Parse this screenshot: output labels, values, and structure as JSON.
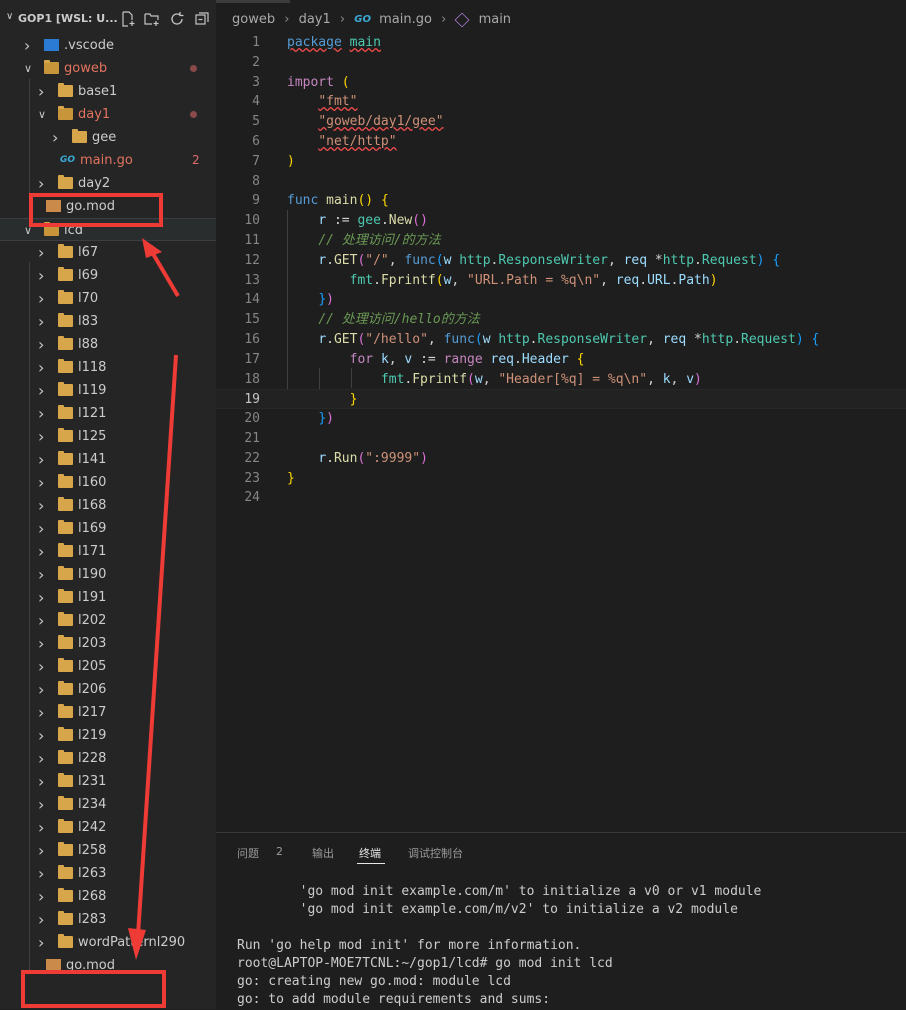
{
  "sidebar": {
    "title": "GOP1 [WSL: U...",
    "tree": [
      {
        "label": ".vscode",
        "icon": "vscode-folder-icon",
        "expanded": false,
        "level": 1
      },
      {
        "label": "goweb",
        "icon": "folder-open-icon",
        "expanded": true,
        "level": 1,
        "modified": true
      },
      {
        "label": "base1",
        "icon": "folder-icon",
        "expanded": false,
        "level": 2
      },
      {
        "label": "day1",
        "icon": "folder-open-icon",
        "expanded": true,
        "level": 2,
        "modified": true
      },
      {
        "label": "gee",
        "icon": "folder-icon",
        "expanded": false,
        "level": 3
      },
      {
        "label": "main.go",
        "icon": "go-file-icon",
        "level": 3,
        "problems": "2"
      },
      {
        "label": "day2",
        "icon": "folder-icon",
        "expanded": false,
        "level": 2
      },
      {
        "label": "go.mod",
        "icon": "gomod-file-icon",
        "level": 2
      },
      {
        "label": "lcd",
        "icon": "folder-open-icon",
        "expanded": true,
        "level": 1,
        "selected": true
      },
      {
        "label": "l67",
        "icon": "folder-icon",
        "expanded": false,
        "level": 2
      },
      {
        "label": "l69",
        "icon": "folder-icon",
        "expanded": false,
        "level": 2
      },
      {
        "label": "l70",
        "icon": "folder-icon",
        "expanded": false,
        "level": 2
      },
      {
        "label": "l83",
        "icon": "folder-icon",
        "expanded": false,
        "level": 2
      },
      {
        "label": "l88",
        "icon": "folder-icon",
        "expanded": false,
        "level": 2
      },
      {
        "label": "l118",
        "icon": "folder-icon",
        "expanded": false,
        "level": 2
      },
      {
        "label": "l119",
        "icon": "folder-icon",
        "expanded": false,
        "level": 2
      },
      {
        "label": "l121",
        "icon": "folder-icon",
        "expanded": false,
        "level": 2
      },
      {
        "label": "l125",
        "icon": "folder-icon",
        "expanded": false,
        "level": 2
      },
      {
        "label": "l141",
        "icon": "folder-icon",
        "expanded": false,
        "level": 2
      },
      {
        "label": "l160",
        "icon": "folder-icon",
        "expanded": false,
        "level": 2
      },
      {
        "label": "l168",
        "icon": "folder-icon",
        "expanded": false,
        "level": 2
      },
      {
        "label": "l169",
        "icon": "folder-icon",
        "expanded": false,
        "level": 2
      },
      {
        "label": "l171",
        "icon": "folder-icon",
        "expanded": false,
        "level": 2
      },
      {
        "label": "l190",
        "icon": "folder-icon",
        "expanded": false,
        "level": 2
      },
      {
        "label": "l191",
        "icon": "folder-icon",
        "expanded": false,
        "level": 2
      },
      {
        "label": "l202",
        "icon": "folder-icon",
        "expanded": false,
        "level": 2
      },
      {
        "label": "l203",
        "icon": "folder-icon",
        "expanded": false,
        "level": 2
      },
      {
        "label": "l205",
        "icon": "folder-icon",
        "expanded": false,
        "level": 2
      },
      {
        "label": "l206",
        "icon": "folder-icon",
        "expanded": false,
        "level": 2
      },
      {
        "label": "l217",
        "icon": "folder-icon",
        "expanded": false,
        "level": 2
      },
      {
        "label": "l219",
        "icon": "folder-icon",
        "expanded": false,
        "level": 2
      },
      {
        "label": "l228",
        "icon": "folder-icon",
        "expanded": false,
        "level": 2
      },
      {
        "label": "l231",
        "icon": "folder-icon",
        "expanded": false,
        "level": 2
      },
      {
        "label": "l234",
        "icon": "folder-icon",
        "expanded": false,
        "level": 2
      },
      {
        "label": "l242",
        "icon": "folder-icon",
        "expanded": false,
        "level": 2
      },
      {
        "label": "l258",
        "icon": "folder-icon",
        "expanded": false,
        "level": 2
      },
      {
        "label": "l263",
        "icon": "folder-icon",
        "expanded": false,
        "level": 2
      },
      {
        "label": "l268",
        "icon": "folder-icon",
        "expanded": false,
        "level": 2
      },
      {
        "label": "l283",
        "icon": "folder-icon",
        "expanded": false,
        "level": 2
      },
      {
        "label": "wordPatternl290",
        "icon": "folder-icon",
        "expanded": false,
        "level": 2
      },
      {
        "label": "go.mod",
        "icon": "gomod-file-icon",
        "level": 2
      }
    ]
  },
  "breadcrumb": [
    "goweb",
    "day1",
    "main.go",
    "main"
  ],
  "editor": {
    "current_line": 19,
    "lines": [
      [
        {
          "t": "package",
          "c": "kw2 squig"
        },
        {
          "t": " ",
          "c": "plain"
        },
        {
          "t": "main",
          "c": "pkg squig"
        }
      ],
      [],
      [
        {
          "t": "import",
          "c": "kw"
        },
        {
          "t": " ",
          "c": "plain"
        },
        {
          "t": "(",
          "c": "br1"
        }
      ],
      [
        {
          "t": "    ",
          "c": "plain"
        },
        {
          "t": "\"fmt\"",
          "c": "str squig"
        }
      ],
      [
        {
          "t": "    ",
          "c": "plain"
        },
        {
          "t": "\"goweb/day1/gee\"",
          "c": "str squig"
        }
      ],
      [
        {
          "t": "    ",
          "c": "plain"
        },
        {
          "t": "\"net/http\"",
          "c": "str squig"
        }
      ],
      [
        {
          "t": ")",
          "c": "br1"
        }
      ],
      [],
      [
        {
          "t": "func",
          "c": "kw2"
        },
        {
          "t": " ",
          "c": "plain"
        },
        {
          "t": "main",
          "c": "fn"
        },
        {
          "t": "()",
          "c": "br1"
        },
        {
          "t": " ",
          "c": "plain"
        },
        {
          "t": "{",
          "c": "br1"
        }
      ],
      [
        {
          "t": "    ",
          "c": "plain"
        },
        {
          "t": "r",
          "c": "id"
        },
        {
          "t": " := ",
          "c": "plain"
        },
        {
          "t": "gee",
          "c": "pkg"
        },
        {
          "t": ".",
          "c": "plain"
        },
        {
          "t": "New",
          "c": "fn"
        },
        {
          "t": "()",
          "c": "br2"
        }
      ],
      [
        {
          "t": "    ",
          "c": "plain"
        },
        {
          "t": "// 处理访问/的方法",
          "c": "cm"
        }
      ],
      [
        {
          "t": "    ",
          "c": "plain"
        },
        {
          "t": "r",
          "c": "id"
        },
        {
          "t": ".",
          "c": "plain"
        },
        {
          "t": "GET",
          "c": "fn"
        },
        {
          "t": "(",
          "c": "br2"
        },
        {
          "t": "\"/\"",
          "c": "str"
        },
        {
          "t": ", ",
          "c": "plain"
        },
        {
          "t": "func",
          "c": "kw2"
        },
        {
          "t": "(",
          "c": "br3"
        },
        {
          "t": "w ",
          "c": "id"
        },
        {
          "t": "http",
          "c": "pkg"
        },
        {
          "t": ".",
          "c": "plain"
        },
        {
          "t": "ResponseWriter",
          "c": "pkg"
        },
        {
          "t": ", ",
          "c": "plain"
        },
        {
          "t": "req ",
          "c": "id"
        },
        {
          "t": "*",
          "c": "plain"
        },
        {
          "t": "http",
          "c": "pkg"
        },
        {
          "t": ".",
          "c": "plain"
        },
        {
          "t": "Request",
          "c": "pkg"
        },
        {
          "t": ")",
          "c": "br3"
        },
        {
          "t": " ",
          "c": "plain"
        },
        {
          "t": "{",
          "c": "br3"
        }
      ],
      [
        {
          "t": "        ",
          "c": "plain"
        },
        {
          "t": "fmt",
          "c": "pkg"
        },
        {
          "t": ".",
          "c": "plain"
        },
        {
          "t": "Fprintf",
          "c": "fn"
        },
        {
          "t": "(",
          "c": "br1"
        },
        {
          "t": "w",
          "c": "id"
        },
        {
          "t": ", ",
          "c": "plain"
        },
        {
          "t": "\"URL.Path = %q\\n\"",
          "c": "str"
        },
        {
          "t": ", ",
          "c": "plain"
        },
        {
          "t": "req",
          "c": "id"
        },
        {
          "t": ".",
          "c": "plain"
        },
        {
          "t": "URL",
          "c": "id"
        },
        {
          "t": ".",
          "c": "plain"
        },
        {
          "t": "Path",
          "c": "id"
        },
        {
          "t": ")",
          "c": "br1"
        }
      ],
      [
        {
          "t": "    ",
          "c": "plain"
        },
        {
          "t": "}",
          "c": "br3"
        },
        {
          "t": ")",
          "c": "br2"
        }
      ],
      [
        {
          "t": "    ",
          "c": "plain"
        },
        {
          "t": "// 处理访问/hello的方法",
          "c": "cm"
        }
      ],
      [
        {
          "t": "    ",
          "c": "plain"
        },
        {
          "t": "r",
          "c": "id"
        },
        {
          "t": ".",
          "c": "plain"
        },
        {
          "t": "GET",
          "c": "fn"
        },
        {
          "t": "(",
          "c": "br2"
        },
        {
          "t": "\"/hello\"",
          "c": "str"
        },
        {
          "t": ", ",
          "c": "plain"
        },
        {
          "t": "func",
          "c": "kw2"
        },
        {
          "t": "(",
          "c": "br3"
        },
        {
          "t": "w ",
          "c": "id"
        },
        {
          "t": "http",
          "c": "pkg"
        },
        {
          "t": ".",
          "c": "plain"
        },
        {
          "t": "ResponseWriter",
          "c": "pkg"
        },
        {
          "t": ", ",
          "c": "plain"
        },
        {
          "t": "req ",
          "c": "id"
        },
        {
          "t": "*",
          "c": "plain"
        },
        {
          "t": "http",
          "c": "pkg"
        },
        {
          "t": ".",
          "c": "plain"
        },
        {
          "t": "Request",
          "c": "pkg"
        },
        {
          "t": ")",
          "c": "br3"
        },
        {
          "t": " ",
          "c": "plain"
        },
        {
          "t": "{",
          "c": "br3"
        }
      ],
      [
        {
          "t": "        ",
          "c": "plain"
        },
        {
          "t": "for",
          "c": "kw"
        },
        {
          "t": " ",
          "c": "plain"
        },
        {
          "t": "k",
          "c": "id"
        },
        {
          "t": ", ",
          "c": "plain"
        },
        {
          "t": "v",
          "c": "id"
        },
        {
          "t": " := ",
          "c": "plain"
        },
        {
          "t": "range",
          "c": "kw"
        },
        {
          "t": " ",
          "c": "plain"
        },
        {
          "t": "req",
          "c": "id"
        },
        {
          "t": ".",
          "c": "plain"
        },
        {
          "t": "Header",
          "c": "id"
        },
        {
          "t": " ",
          "c": "plain"
        },
        {
          "t": "{",
          "c": "br1"
        }
      ],
      [
        {
          "t": "            ",
          "c": "plain"
        },
        {
          "t": "fmt",
          "c": "pkg"
        },
        {
          "t": ".",
          "c": "plain"
        },
        {
          "t": "Fprintf",
          "c": "fn"
        },
        {
          "t": "(",
          "c": "br2"
        },
        {
          "t": "w",
          "c": "id"
        },
        {
          "t": ", ",
          "c": "plain"
        },
        {
          "t": "\"Header[%q] = %q\\n\"",
          "c": "str"
        },
        {
          "t": ", ",
          "c": "plain"
        },
        {
          "t": "k",
          "c": "id"
        },
        {
          "t": ", ",
          "c": "plain"
        },
        {
          "t": "v",
          "c": "id"
        },
        {
          "t": ")",
          "c": "br2"
        }
      ],
      [
        {
          "t": "        ",
          "c": "plain"
        },
        {
          "t": "}",
          "c": "br1"
        }
      ],
      [
        {
          "t": "    ",
          "c": "plain"
        },
        {
          "t": "}",
          "c": "br3"
        },
        {
          "t": ")",
          "c": "br2"
        }
      ],
      [],
      [
        {
          "t": "    ",
          "c": "plain"
        },
        {
          "t": "r",
          "c": "id"
        },
        {
          "t": ".",
          "c": "plain"
        },
        {
          "t": "Run",
          "c": "fn"
        },
        {
          "t": "(",
          "c": "br2"
        },
        {
          "t": "\":9999\"",
          "c": "str"
        },
        {
          "t": ")",
          "c": "br2"
        }
      ],
      [
        {
          "t": "}",
          "c": "br1"
        }
      ],
      []
    ]
  },
  "panel": {
    "tabs": [
      {
        "label": "问题",
        "badge": "2",
        "active": false
      },
      {
        "label": "输出",
        "active": false
      },
      {
        "label": "终端",
        "active": true
      },
      {
        "label": "调试控制台",
        "active": false
      }
    ],
    "terminal_lines": [
      "        'go mod init example.com/m' to initialize a v0 or v1 module",
      "        'go mod init example.com/m/v2' to initialize a v2 module",
      "",
      "Run 'go help mod init' for more information.",
      "root@LAPTOP-MOE7TCNL:~/gop1/lcd# go mod init lcd",
      "go: creating new go.mod: module lcd",
      "go: to add module requirements and sums:"
    ]
  },
  "colors": {
    "annotation_red": "#ef3b36",
    "modified_text": "#e2735e",
    "folder": "#d7a64a"
  }
}
